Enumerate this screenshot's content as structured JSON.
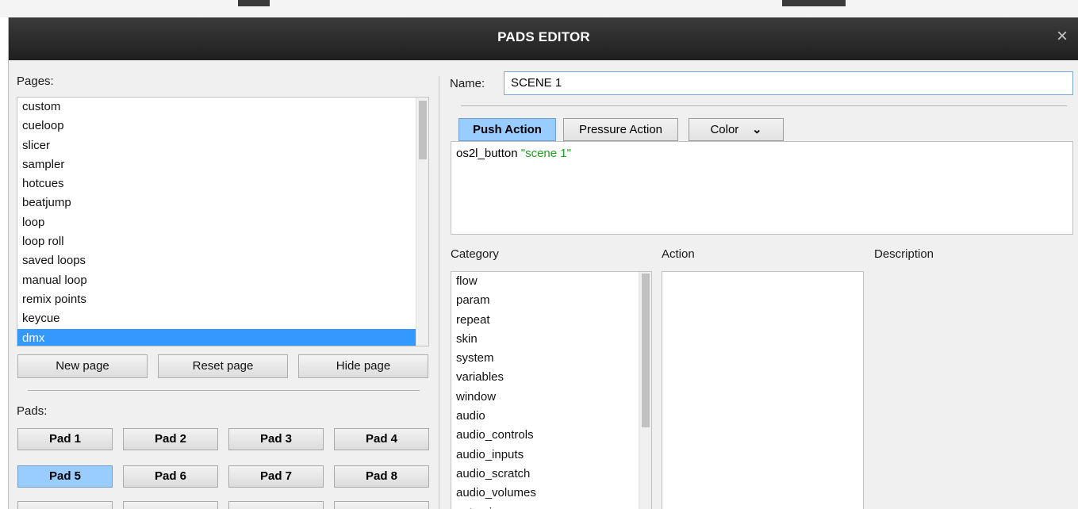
{
  "window": {
    "title": "PADS EDITOR",
    "close_glyph": "×"
  },
  "pages": {
    "label": "Pages:",
    "items": [
      "custom",
      "cueloop",
      "slicer",
      "sampler",
      "hotcues",
      "beatjump",
      "loop",
      "loop roll",
      "saved loops",
      "manual loop",
      "remix points",
      "keycue",
      "dmx"
    ],
    "selected": "dmx",
    "buttons": {
      "new": "New page",
      "reset": "Reset page",
      "hide": "Hide page"
    }
  },
  "pads": {
    "label": "Pads:",
    "row1": [
      "Pad 1",
      "Pad 2",
      "Pad 3",
      "Pad 4"
    ],
    "row2": [
      "Pad 5",
      "Pad 6",
      "Pad 7",
      "Pad 8"
    ],
    "active": "Pad 5"
  },
  "editor": {
    "name_label": "Name:",
    "name_value": "SCENE 1",
    "tabs": {
      "push": "Push Action",
      "pressure": "Pressure Action",
      "color": "Color",
      "color_glyph": "⌄"
    },
    "script": {
      "command": "os2l_button",
      "argument": "\"scene 1\""
    }
  },
  "browser": {
    "category_label": "Category",
    "action_label": "Action",
    "description_label": "Description",
    "categories": [
      "flow",
      "param",
      "repeat",
      "skin",
      "system",
      "variables",
      "window",
      "audio",
      "audio_controls",
      "audio_inputs",
      "audio_scratch",
      "audio_volumes",
      "automix"
    ]
  },
  "colors": {
    "accent": "#99ccff",
    "selection": "#3399ff",
    "titlebar": "#2b2b2b",
    "string": "#20a020"
  }
}
